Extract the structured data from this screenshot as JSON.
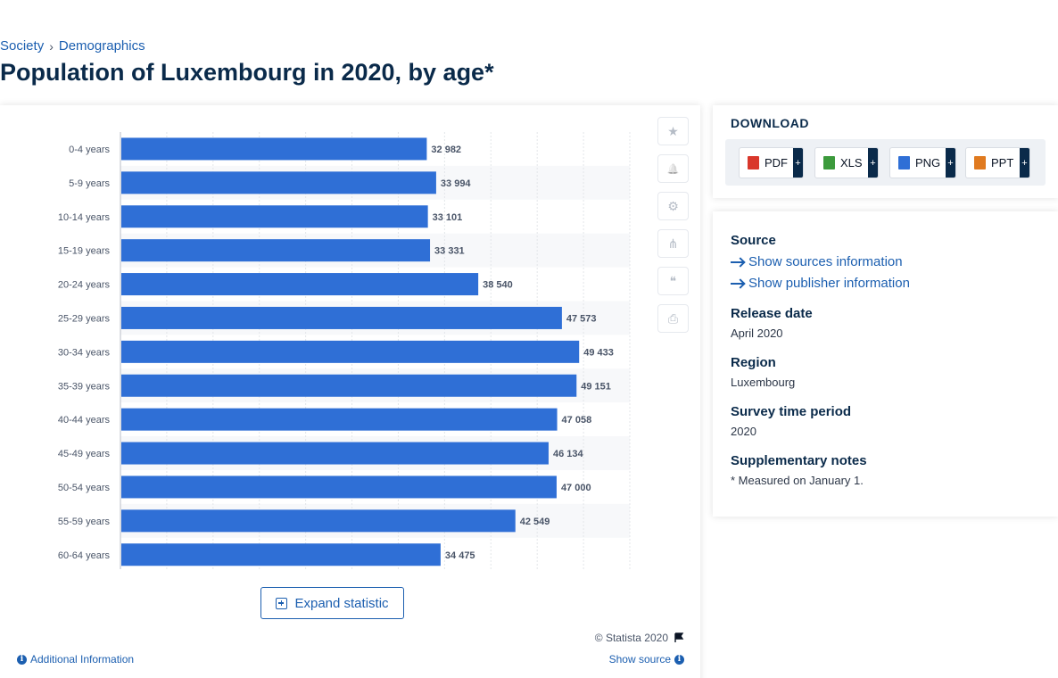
{
  "breadcrumb": {
    "items": [
      "Society",
      "Demographics"
    ],
    "separator": "›"
  },
  "page_title": "Population of Luxembourg in 2020, by age*",
  "chart_data": {
    "type": "bar",
    "orientation": "horizontal",
    "categories": [
      "0-4 years",
      "5-9 years",
      "10-14 years",
      "15-19 years",
      "20-24 years",
      "25-29 years",
      "30-34 years",
      "35-39 years",
      "40-44 years",
      "45-49 years",
      "50-54 years",
      "55-59 years",
      "60-64 years"
    ],
    "values": [
      32982,
      33994,
      33101,
      33331,
      38540,
      47573,
      49433,
      49151,
      47058,
      46134,
      47000,
      42549,
      34475
    ],
    "value_labels": [
      "32 982",
      "33 994",
      "33 101",
      "33 331",
      "38 540",
      "47 573",
      "49 433",
      "49 151",
      "47 058",
      "46 134",
      "47 000",
      "42 549",
      "34 475"
    ],
    "xlim": [
      0,
      55000
    ],
    "grid": true,
    "bar_color": "#2f6fd6",
    "title": "",
    "xlabel": "",
    "ylabel": ""
  },
  "tools": {
    "icons": [
      "star-icon",
      "bell-icon",
      "gear-icon",
      "share-icon",
      "quote-icon",
      "print-icon"
    ],
    "glyphs": [
      "★",
      "🔔",
      "⚙",
      "⋔",
      "❝",
      "⎙"
    ]
  },
  "expand_label": "Expand statistic",
  "copyright": "© Statista 2020",
  "additional_info": "Additional Information",
  "show_source": "Show source",
  "download": {
    "title": "DOWNLOAD",
    "buttons": [
      {
        "label": "PDF",
        "icon": "pdf-file-icon",
        "color": "#d9372b"
      },
      {
        "label": "XLS",
        "icon": "xls-file-icon",
        "color": "#3c9a3c"
      },
      {
        "label": "PNG",
        "icon": "png-file-icon",
        "color": "#2f6fd6"
      },
      {
        "label": "PPT",
        "icon": "ppt-file-icon",
        "color": "#e07a1f"
      }
    ],
    "plus": "+"
  },
  "info": {
    "source_label": "Source",
    "show_sources": "Show sources information",
    "show_publisher": "Show publisher information",
    "release_label": "Release date",
    "release_value": "April 2020",
    "region_label": "Region",
    "region_value": "Luxembourg",
    "period_label": "Survey time period",
    "period_value": "2020",
    "notes_label": "Supplementary notes",
    "notes_value": "* Measured on January 1."
  }
}
